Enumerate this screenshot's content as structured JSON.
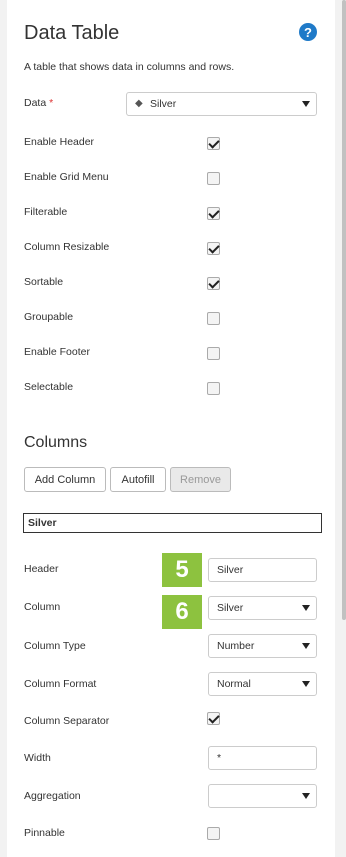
{
  "panel": {
    "title": "Data Table",
    "help_icon": "?",
    "description": "A table that shows data in columns and rows."
  },
  "data_field": {
    "label": "Data",
    "required_mark": "*",
    "value": "Silver"
  },
  "options": [
    {
      "label": "Enable Header",
      "checked": true
    },
    {
      "label": "Enable Grid Menu",
      "checked": false
    },
    {
      "label": "Filterable",
      "checked": true
    },
    {
      "label": "Column Resizable",
      "checked": true
    },
    {
      "label": "Sortable",
      "checked": true
    },
    {
      "label": "Groupable",
      "checked": false
    },
    {
      "label": "Enable Footer",
      "checked": false
    },
    {
      "label": "Selectable",
      "checked": false
    }
  ],
  "columns": {
    "title": "Columns",
    "add_column_label": "Add Column",
    "autofill_label": "Autofill",
    "remove_label": "Remove",
    "selected_column": "Silver"
  },
  "column_props": {
    "header_label": "Header",
    "header_value": "Silver",
    "column_label": "Column",
    "column_value": "Silver",
    "type_label": "Column Type",
    "type_value": "Number",
    "format_label": "Column Format",
    "format_value": "Normal",
    "separator_label": "Column Separator",
    "separator_checked": true,
    "width_label": "Width",
    "width_value": "*",
    "aggregation_label": "Aggregation",
    "aggregation_value": "",
    "pinnable_label": "Pinnable",
    "pinnable_checked": false
  },
  "badges": {
    "header_badge": "5",
    "column_badge": "6"
  },
  "colors": {
    "badge": "#8dc23f",
    "help": "#1f7ac8",
    "required": "#dd3333"
  }
}
